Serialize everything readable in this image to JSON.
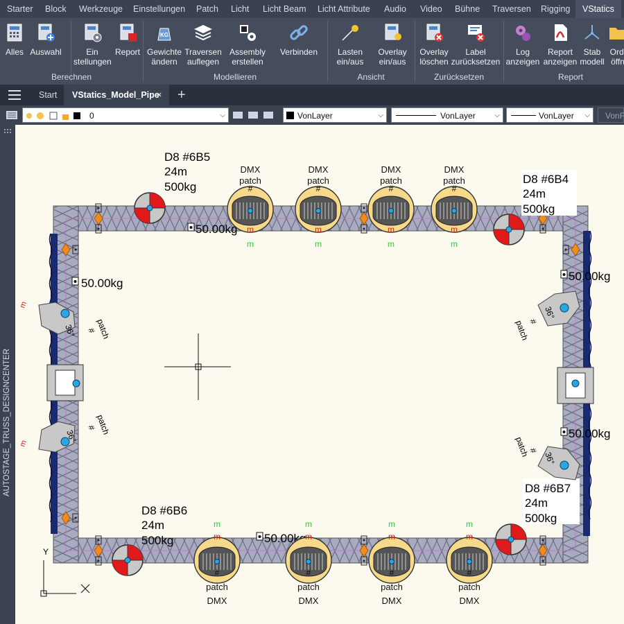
{
  "menu": {
    "items": [
      "Starter",
      "Block",
      "Werkzeuge",
      "Einstellungen",
      "Patch",
      "Licht",
      "Licht Beam",
      "Licht Attribute",
      "Audio",
      "Video",
      "Bühne",
      "Traversen",
      "Rigging",
      "VStatics"
    ],
    "active": "VStatics"
  },
  "ribbon": {
    "buttons": {
      "alles": "Alles",
      "auswahl": "Auswahl",
      "einstellungen": "Ein\nstellungen",
      "report": "Report",
      "gewichte": "Gewichte\nändern",
      "traversen": "Traversen\nauflegen",
      "assembly": "Assembly\nerstellen",
      "verbinden": "Verbinden",
      "lasten": "Lasten\nein/aus",
      "overlay": "Overlay\nein/aus",
      "overlay_loeschen": "Overlay\nlöschen",
      "label_zurueck": "Label\nzurücksetzen",
      "log": "Log\nanzeigen",
      "report_anzeigen": "Report\nanzeigen",
      "stab": "Stab\nmodell",
      "ordner": "Ordi\nöffn"
    },
    "groups": {
      "berechnen": "Berechnen",
      "modellieren": "Modellieren",
      "ansicht": "Ansicht",
      "zuruecksetzen": "Zurücksetzen",
      "report": "Report"
    },
    "icons": {
      "kg_text": "KG"
    }
  },
  "tabs": {
    "start": "Start",
    "file": "VStatics_Model_Pipe",
    "close": "×",
    "add": "+"
  },
  "props": {
    "layer": "0",
    "color": "VonLayer",
    "linetype": "VonLayer",
    "lineweight": "VonLayer",
    "plotstyle": "VonFa"
  },
  "sidebar": {
    "title": "AUTOSTAGE_TRUSS_DESIGNCENTER"
  },
  "drawing": {
    "motors": [
      {
        "id": "D8  #6B5",
        "length": "24m",
        "load": "500kg"
      },
      {
        "id": "D8  #6B4",
        "length": "24m",
        "load": "500kg"
      },
      {
        "id": "D8  #6B6",
        "length": "24m",
        "load": "500kg"
      },
      {
        "id": "D8  #6B7",
        "length": "24m",
        "load": "500kg"
      }
    ],
    "point_load": "50.00kg",
    "fixture": {
      "dmx": "DMX",
      "patch": "patch",
      "hash": "#",
      "m": "m",
      "angle": "36°"
    },
    "ucs": {
      "y": "Y"
    }
  },
  "colors": {
    "truss": "#a9abc0",
    "canvas": "#fcfaee",
    "fixture_fill": "#f7d98b",
    "motor_red": "#e01a1a",
    "pipe": "#1a2a6e",
    "marker_orange": "#f08c1e",
    "green_m": "#2fcf2f",
    "red_m": "#d21e1e"
  }
}
